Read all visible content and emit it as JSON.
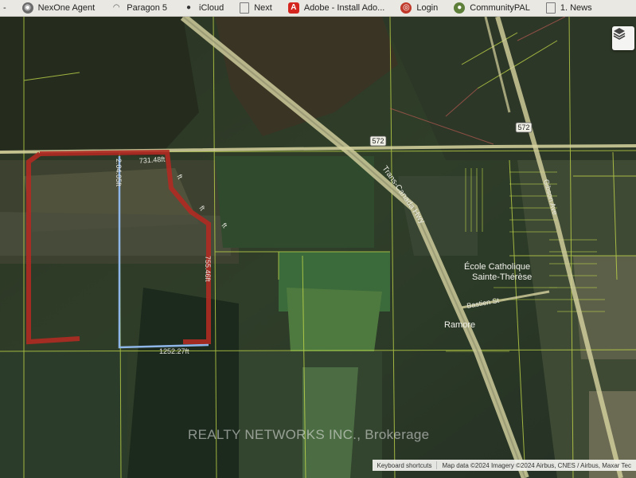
{
  "bookmarks": [
    {
      "label": "-",
      "icon": "dash-icon"
    },
    {
      "label": "NexOne Agent",
      "icon": "globe-icon"
    },
    {
      "label": "Paragon 5",
      "icon": "rainbow-icon"
    },
    {
      "label": "iCloud",
      "icon": "apple-icon"
    },
    {
      "label": "Next",
      "icon": "page-icon"
    },
    {
      "label": "Adobe - Install Ado...",
      "icon": "adobe-icon"
    },
    {
      "label": "Login",
      "icon": "login-icon"
    },
    {
      "label": "CommunityPAL",
      "icon": "community-icon"
    },
    {
      "label": "1. News",
      "icon": "page-icon"
    }
  ],
  "map": {
    "layers_button_icon": "layers-icon",
    "road_labels": {
      "hwy572_a": "572",
      "hwy572_b": "572",
      "trans_canada": "Trans-Canada Hwy",
      "bastien": "Bastien St",
      "gibson": "Gibson Ave"
    },
    "place_labels": {
      "town": "Ramore",
      "school_line1": "École Catholique",
      "school_line2": "Sainte-Thérèse"
    },
    "measurements": {
      "north_edge": "731.48ft",
      "west_inner_edge": "2.04.05ft",
      "ne_diag_a": "ft",
      "ne_diag_b": "ft",
      "ne_diag_c": "ft",
      "east_edge": "755.46ft",
      "south_edge": "1252.27ft"
    },
    "watermark": "REALTY NETWORKS INC., Brokerage",
    "attribution": {
      "shortcuts": "Keyboard shortcuts",
      "data": "Map data ©2024 Imagery ©2024 Airbus, CNES / Airbus, Maxar Tec"
    },
    "colors": {
      "parcel_outline": "#b02a22",
      "measure_line": "#8fb6e8",
      "lot_lines": "#c9e04a",
      "road_fill": "#d7d3a0"
    }
  }
}
